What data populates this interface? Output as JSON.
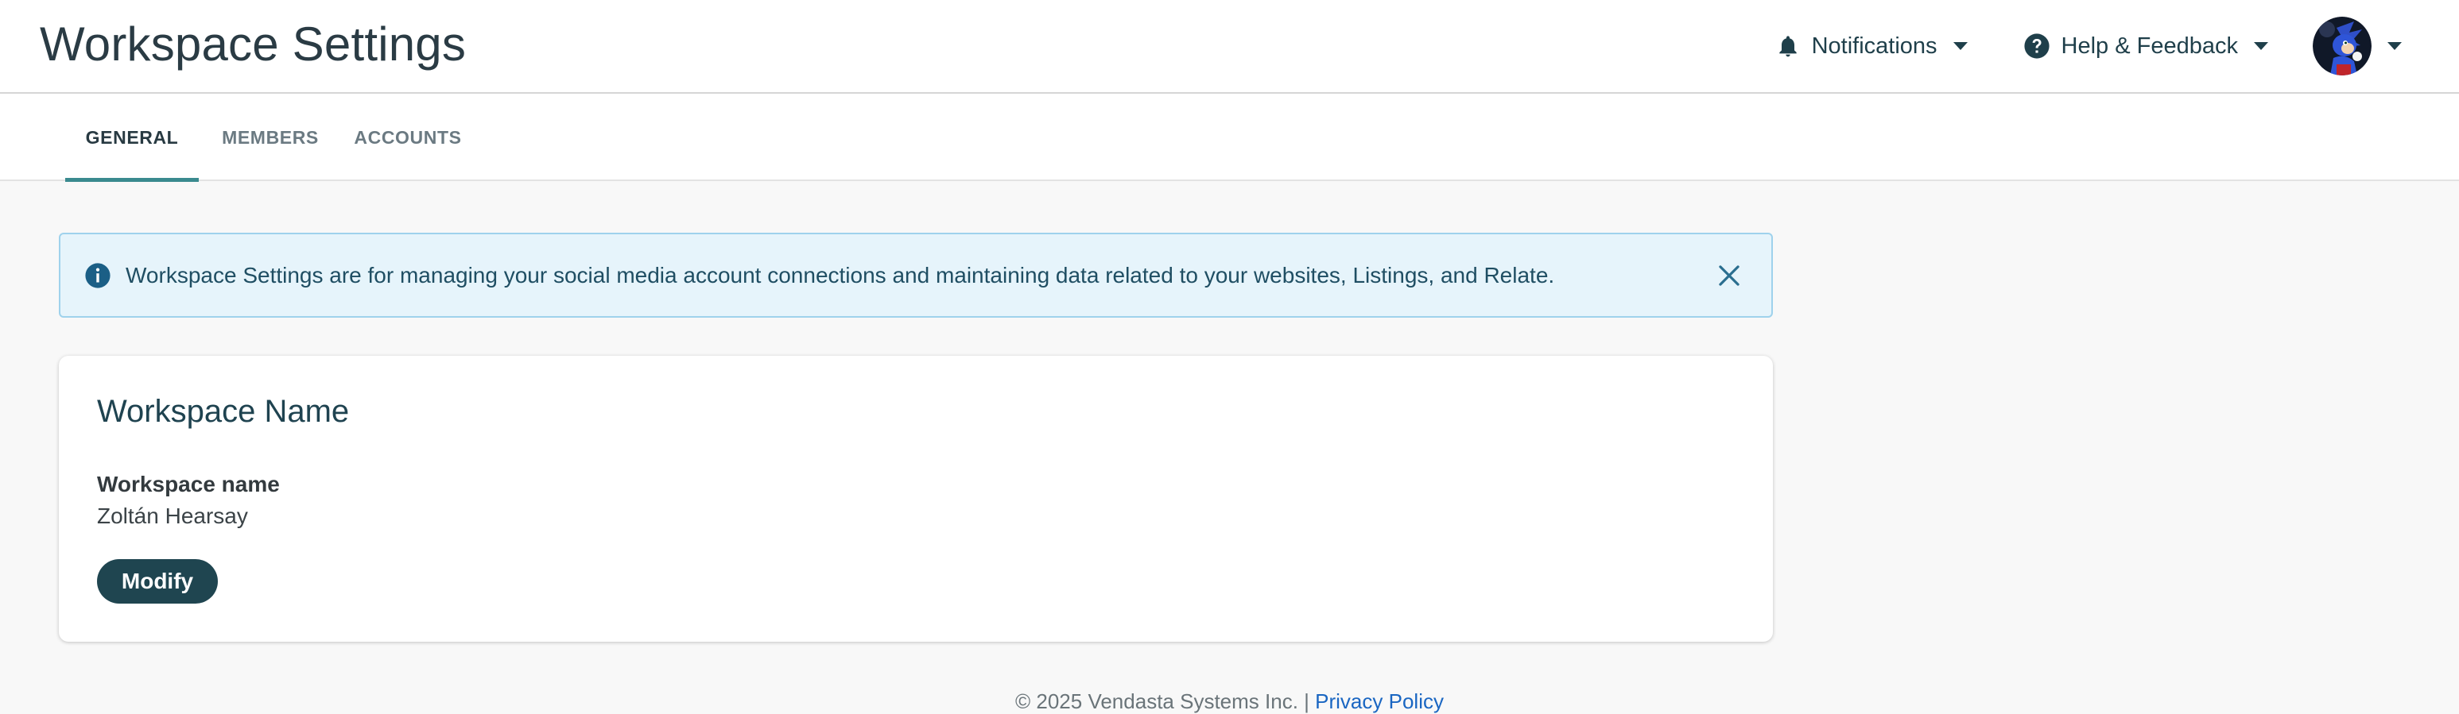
{
  "header": {
    "title": "Workspace Settings",
    "notifications_label": "Notifications",
    "help_label": "Help & Feedback"
  },
  "tabs": [
    {
      "label": "GENERAL",
      "active": true
    },
    {
      "label": "MEMBERS",
      "active": false
    },
    {
      "label": "ACCOUNTS",
      "active": false
    }
  ],
  "banner": {
    "text": "Workspace Settings are for managing your social media account connections and maintaining data related to your websites, Listings, and Relate."
  },
  "card": {
    "title": "Workspace Name",
    "field_label": "Workspace name",
    "field_value": "Zoltán Hearsay",
    "modify_label": "Modify"
  },
  "footer": {
    "copyright": "© 2025 Vendasta Systems Inc.",
    "separator": "|",
    "privacy_label": "Privacy Policy"
  },
  "icons": {
    "notifications": "bell-icon",
    "help": "question-circle-icon",
    "user": "avatar",
    "dropdown": "caret-down-icon",
    "info": "info-circle-icon",
    "close": "close-icon"
  },
  "colors": {
    "accent": "#3a8a8f",
    "primary_button": "#1f4550",
    "banner_bg": "#e6f4fb",
    "banner_border": "#9fd2ec",
    "link": "#1a66c2"
  }
}
